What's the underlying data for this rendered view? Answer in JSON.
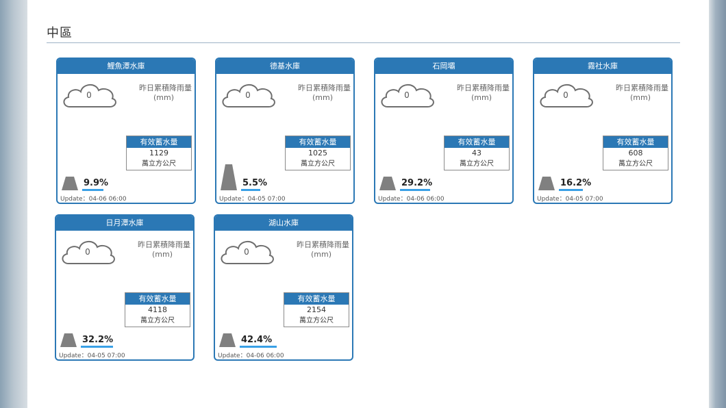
{
  "region": "中區",
  "labels": {
    "rain_label": "昨日累積降雨量",
    "rain_unit": "(mm)",
    "storage_header": "有效蓄水量",
    "storage_unit": "萬立方公尺"
  },
  "reservoirs": [
    {
      "name": "鯉魚潭水庫",
      "rain": "0",
      "storage": "1129",
      "percent": "9.9%",
      "percent_value": 9.9,
      "update": "Update：04-06 06:00"
    },
    {
      "name": "德基水庫",
      "rain": "0",
      "storage": "1025",
      "percent": "5.5%",
      "percent_value": 5.5,
      "update": "Update：04-05 07:00"
    },
    {
      "name": "石岡壩",
      "rain": "0",
      "storage": "43",
      "percent": "29.2%",
      "percent_value": 29.2,
      "update": "Update：04-06 06:00"
    },
    {
      "name": "霧社水庫",
      "rain": "0",
      "storage": "608",
      "percent": "16.2%",
      "percent_value": 16.2,
      "update": "Update：04-05 07:00"
    },
    {
      "name": "日月潭水庫",
      "rain": "0",
      "storage": "4118",
      "percent": "32.2%",
      "percent_value": 32.2,
      "update": "Update：04-05 07:00"
    },
    {
      "name": "湖山水庫",
      "rain": "0",
      "storage": "2154",
      "percent": "42.4%",
      "percent_value": 42.4,
      "update": "Update：04-06 06:00"
    }
  ],
  "colors": {
    "accent": "#2b78b5",
    "bar": "#39a0e6",
    "tank": "#808080"
  },
  "icons": {
    "cloud": "cloud-icon",
    "tank": "reservoir-level-icon"
  }
}
